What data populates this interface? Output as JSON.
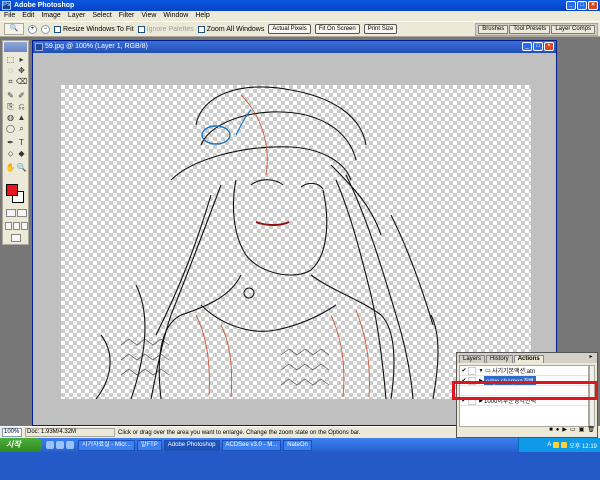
{
  "app": {
    "title": "Adobe Photoshop",
    "window_buttons": [
      "_",
      "□",
      "×"
    ]
  },
  "menubar": {
    "items": [
      "File",
      "Edit",
      "Image",
      "Layer",
      "Select",
      "Filter",
      "View",
      "Window",
      "Help"
    ]
  },
  "options": {
    "tool_glyph": "🔍",
    "zoom_in": "+",
    "zoom_out": "−",
    "resize_label": "Resize Windows To Fit",
    "ignore_palettes_label": "Ignore Palettes",
    "zoom_all_label": "Zoom All Windows",
    "actual_pixels": "Actual Pixels",
    "fit_on_screen": "Fit On Screen",
    "print_size": "Print Size",
    "palette_well": [
      "Brushes",
      "Tool Presets",
      "Layer Comps"
    ]
  },
  "toolbox": {
    "tools": [
      "⬚",
      "▸",
      "◌",
      "✥",
      "⌗",
      "⌫",
      "✎",
      "✐",
      "⎘",
      "⎌",
      "◍",
      "▲",
      "◯",
      "⌕",
      "✒",
      "T",
      "⬦",
      "◆",
      "✋",
      "🔍"
    ],
    "colors": {
      "foreground": "#e8151b",
      "background": "#ffffff"
    }
  },
  "document": {
    "title": "59.jpg @ 100% (Layer 1, RGB/8)",
    "buttons": [
      "_",
      "□",
      "×"
    ]
  },
  "status": {
    "zoom": "100%",
    "doc_info": "Doc: 1.93M/4.32M",
    "hint": "Click or drag over the area you want to enlarge. Change the zoom state on the Options bar."
  },
  "palette": {
    "tabs": [
      "Layers",
      "History",
      "Actions"
    ],
    "active_tab": "Actions",
    "menu_glyph": "▸",
    "actions": [
      {
        "check": "✔",
        "tri": "▼",
        "icon": "▭",
        "label": "사기기본액션.atn",
        "selected": false
      },
      {
        "check": "✔",
        "tri": "▶",
        "icon": "",
        "label": "edge sharpen가벼",
        "selected": true
      },
      {
        "check": "✔",
        "tri": "▶",
        "icon": "",
        "label": "1000이두운영역선택",
        "selected": false
      }
    ],
    "bottom_icons": [
      "■",
      "●",
      "▶",
      "▭",
      "▣",
      "🗑"
    ]
  },
  "taskbar": {
    "start_label": "시작",
    "tasks": [
      "시기자료실 - Micr...",
      "알FTP",
      "Adobe Photoshop",
      "ACDSee v3.0 - M...",
      "NateOn"
    ],
    "active_task": "Adobe Photoshop",
    "clock": "오후 12:19",
    "lang_indicator": "A"
  }
}
